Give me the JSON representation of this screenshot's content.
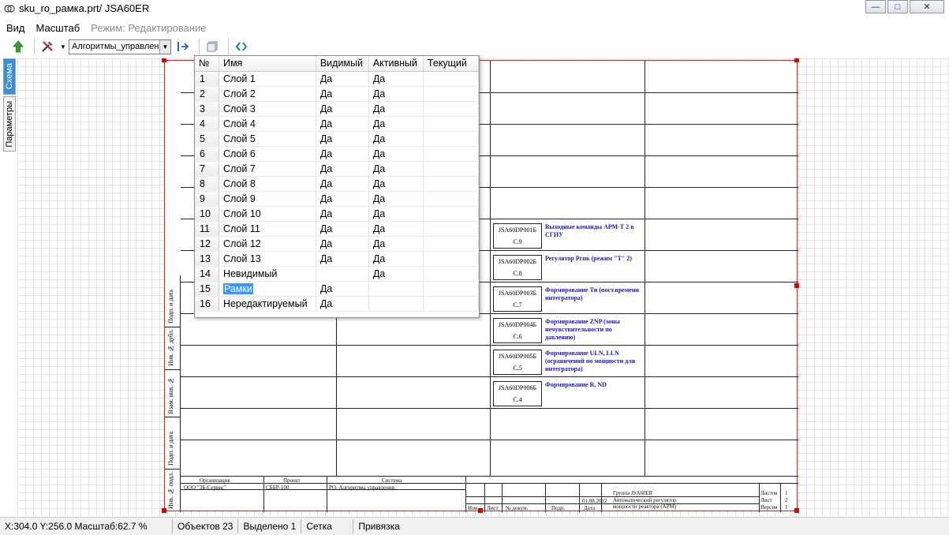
{
  "window": {
    "title": "sku_ro_рамка.prt/ JSA60ER"
  },
  "menu": {
    "items": [
      "Вид",
      "Масштаб"
    ],
    "mode_label": "Режим: Редактирование"
  },
  "toolbar": {
    "combo_value": "Алгоритмы_управлен"
  },
  "left_tabs": {
    "schema": "Схема",
    "params": "Параметры"
  },
  "layers": {
    "headers": [
      "№",
      "Имя",
      "Видимый",
      "Активный",
      "Текущий"
    ],
    "rows": [
      {
        "n": "1",
        "name": "Слой 1",
        "visible": "Да",
        "active": "Да",
        "current": ""
      },
      {
        "n": "2",
        "name": "Слой 2",
        "visible": "Да",
        "active": "Да",
        "current": ""
      },
      {
        "n": "3",
        "name": "Слой 3",
        "visible": "Да",
        "active": "Да",
        "current": ""
      },
      {
        "n": "4",
        "name": "Слой 4",
        "visible": "Да",
        "active": "Да",
        "current": ""
      },
      {
        "n": "5",
        "name": "Слой 5",
        "visible": "Да",
        "active": "Да",
        "current": ""
      },
      {
        "n": "6",
        "name": "Слой 6",
        "visible": "Да",
        "active": "Да",
        "current": ""
      },
      {
        "n": "7",
        "name": "Слой 7",
        "visible": "Да",
        "active": "Да",
        "current": ""
      },
      {
        "n": "8",
        "name": "Слой 8",
        "visible": "Да",
        "active": "Да",
        "current": ""
      },
      {
        "n": "9",
        "name": "Слой 9",
        "visible": "Да",
        "active": "Да",
        "current": ""
      },
      {
        "n": "10",
        "name": "Слой 10",
        "visible": "Да",
        "active": "Да",
        "current": ""
      },
      {
        "n": "11",
        "name": "Слой 11",
        "visible": "Да",
        "active": "Да",
        "current": ""
      },
      {
        "n": "12",
        "name": "Слой 12",
        "visible": "Да",
        "active": "Да",
        "current": ""
      },
      {
        "n": "13",
        "name": "Слой 13",
        "visible": "Да",
        "active": "Да",
        "current": ""
      },
      {
        "n": "14",
        "name": "Невидимый",
        "visible": "",
        "active": "Да",
        "current": ""
      },
      {
        "n": "15",
        "name": "Рамки",
        "visible": "Да",
        "active": "",
        "current": ""
      },
      {
        "n": "16",
        "name": "Нередактируемый",
        "visible": "Да",
        "active": "",
        "current": ""
      }
    ]
  },
  "drawing": {
    "blocks": [
      {
        "code": "JSA60DP001Б",
        "sheet": "С.9",
        "desc": "Выходные команды АРМ-Т 2 в СГИУ"
      },
      {
        "code": "JSA60DP002Б",
        "sheet": "С.8",
        "desc": "Регулятор Pгпк (режим \"Т\" 2)"
      },
      {
        "code": "JSA60DP003Б",
        "sheet": "С.7",
        "desc": "Формирование Ти (пост.времени интегратора)"
      },
      {
        "code": "JSA60DP004Б",
        "sheet": "С.6",
        "desc": "Формирование ZNP (зоны нечувствительности по давлению)"
      },
      {
        "code": "JSA60DP005Б",
        "sheet": "С.5",
        "desc": "Формирование ULN, LLN (ограничений по мощности для интегратора)"
      },
      {
        "code": "JSA60DP006Б",
        "sheet": "С.4",
        "desc": "Формирование R, ND"
      }
    ],
    "side_labels": [
      "Подп. и дата",
      "Инв. № дубл.",
      "Взам. инв. №",
      "Подп. и дата",
      "Инв. № подл."
    ],
    "stamp": {
      "org_h": "Организация",
      "org_v": "ООО \"ЗБ-Сервис\"",
      "proj_h": "Проект",
      "proj_v": "СББР-100",
      "sys_h": "Система",
      "sys_v": "РО. Алгоритмы управления.",
      "izm": "Изм.",
      "list": "Лист",
      "docnum": "№ докум.",
      "podp": "Подп.",
      "date_h": "Дата",
      "date_v": "01.08.2012",
      "group": "Группа JSA60ER",
      "desc1": "Автоматический регулятор",
      "desc2": "мощности реактора (АРМ)",
      "listov_h": "Листов",
      "listov_v": "1",
      "list_h": "Лист",
      "list_v": "2",
      "ver_h": "Версия",
      "ver_v": "1"
    }
  },
  "status": {
    "coords": "X:304.0  Y:256.0  Масштаб:62.7 %",
    "objects": "Объектов 23",
    "selected": "Выделено 1",
    "grid": "Сетка",
    "snap": "Привязка"
  }
}
